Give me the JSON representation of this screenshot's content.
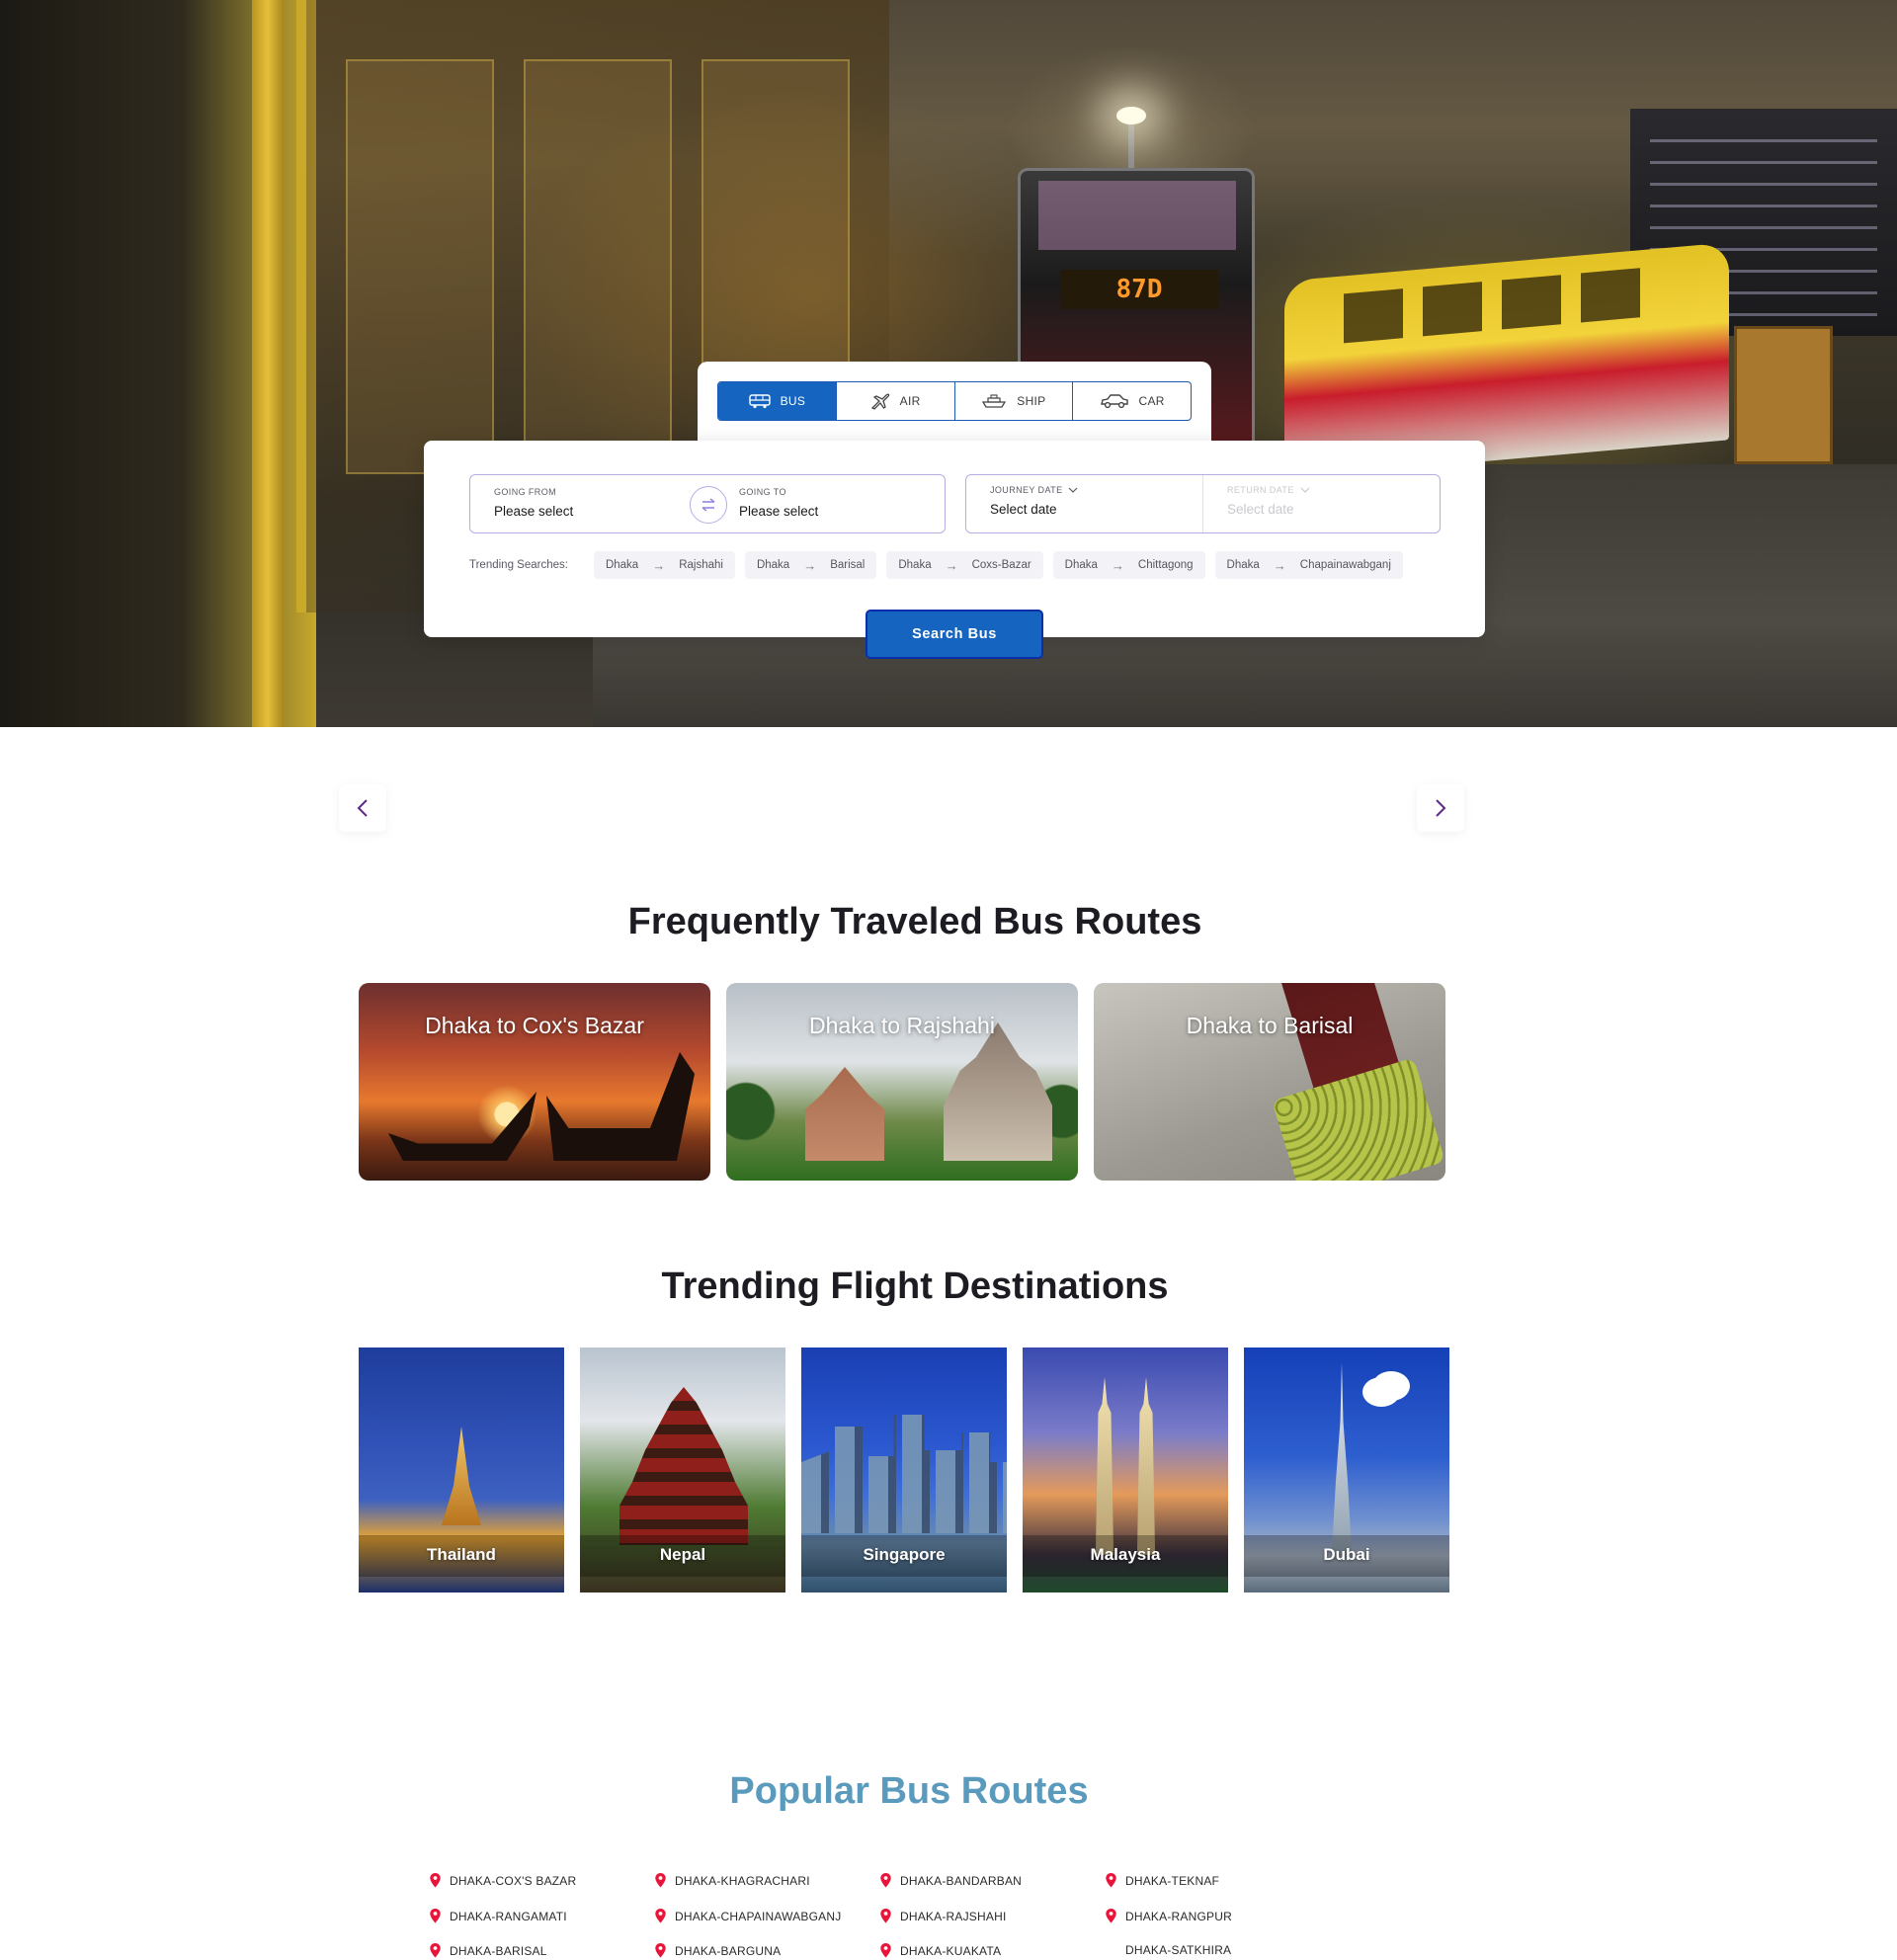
{
  "tabs": [
    {
      "label": "BUS",
      "icon": "bus-icon",
      "active": true
    },
    {
      "label": "AIR",
      "icon": "airplane-icon",
      "active": false
    },
    {
      "label": "SHIP",
      "icon": "ship-icon",
      "active": false
    },
    {
      "label": "CAR",
      "icon": "car-icon",
      "active": false
    }
  ],
  "search": {
    "from_label": "GOING FROM",
    "from_value": "Please select",
    "to_label": "GOING TO",
    "to_value": "Please select",
    "journey_label": "JOURNEY DATE",
    "journey_value": "Select date",
    "return_label": "RETURN DATE",
    "return_value": "Select date",
    "trending_label": "Trending Searches:",
    "trending": [
      {
        "from": "Dhaka",
        "to": "Rajshahi"
      },
      {
        "from": "Dhaka",
        "to": "Barisal"
      },
      {
        "from": "Dhaka",
        "to": "Coxs-Bazar"
      },
      {
        "from": "Dhaka",
        "to": "Chittagong"
      },
      {
        "from": "Dhaka",
        "to": "Chapainawabganj"
      }
    ],
    "button": "Search Bus"
  },
  "hero": {
    "bus_sign": "87D"
  },
  "frequent": {
    "title": "Frequently Traveled Bus Routes",
    "routes": [
      "Dhaka to Cox's Bazar",
      "Dhaka to Rajshahi",
      "Dhaka to Barisal"
    ]
  },
  "flights": {
    "title": "Trending Flight Destinations",
    "destinations": [
      "Thailand",
      "Nepal",
      "Singapore",
      "Malaysia",
      "Dubai"
    ]
  },
  "popular": {
    "title": "Popular Bus Routes",
    "routes": [
      "DHAKA-COX'S BAZAR",
      "DHAKA-KHAGRACHARI",
      "DHAKA-BANDARBAN",
      "DHAKA-TEKNAF",
      "DHAKA-RANGAMATI",
      "DHAKA-CHAPAINAWABGANJ",
      "DHAKA-RAJSHAHI",
      "DHAKA-RANGPUR",
      "DHAKA-BARISAL",
      "DHAKA-BARGUNA",
      "DHAKA-KUAKATA",
      "DHAKA-SATKHIRA"
    ]
  },
  "colors": {
    "primary": "#1565c0",
    "accent_purple": "#b9abe6",
    "popular_title": "#5a9bbd",
    "pin": "#e8153a"
  }
}
